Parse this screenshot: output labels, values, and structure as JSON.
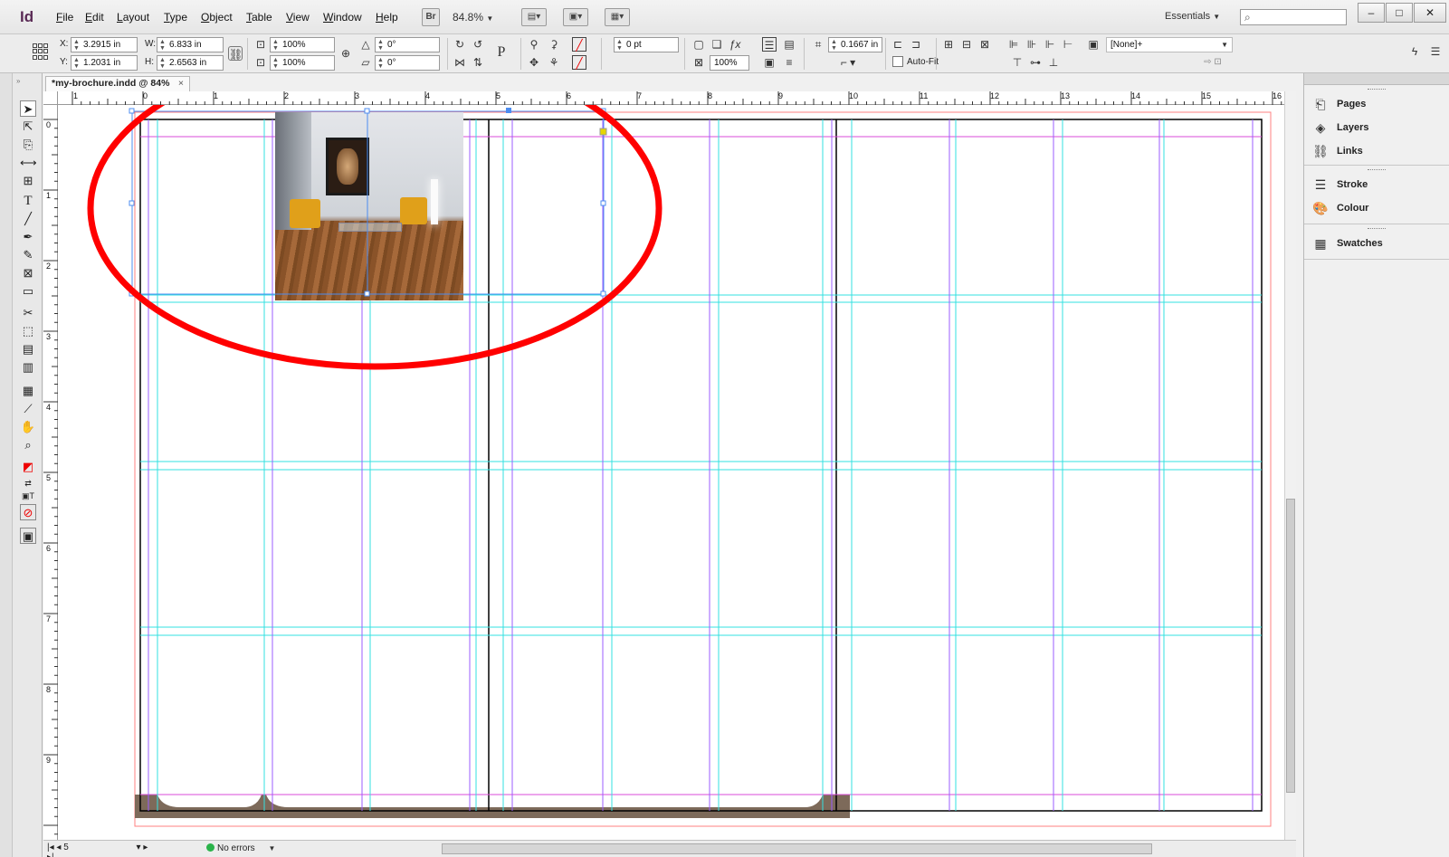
{
  "app": {
    "logo": "Id"
  },
  "menu": [
    "File",
    "Edit",
    "Layout",
    "Type",
    "Object",
    "Table",
    "View",
    "Window",
    "Help"
  ],
  "menubar": {
    "bridge_label": "Br",
    "zoom": "84.8%",
    "workspace": "Essentials",
    "search_placeholder": ""
  },
  "control": {
    "x_label": "X:",
    "x_value": "3.2915 in",
    "y_label": "Y:",
    "y_value": "1.2031 in",
    "w_label": "W:",
    "w_value": "6.833 in",
    "h_label": "H:",
    "h_value": "2.6563 in",
    "scale_x": "100%",
    "scale_y": "100%",
    "rotate": "0°",
    "shear": "0°",
    "stroke_weight": "0 pt",
    "opacity": "100%",
    "corner": "0.1667 in",
    "autofit": "Auto-Fit",
    "object_style": "[None]+"
  },
  "document": {
    "tab_title": "*my-brochure.indd @ 84%",
    "close": "×"
  },
  "ruler": {
    "top": [
      "1",
      "0",
      "1",
      "2",
      "3",
      "4",
      "5",
      "6",
      "7",
      "8",
      "9",
      "10",
      "11",
      "12",
      "13",
      "14",
      "15",
      "16"
    ],
    "left": [
      "0",
      "1",
      "2",
      "3",
      "4",
      "5",
      "6",
      "7",
      "8",
      "9"
    ]
  },
  "status": {
    "page": "5",
    "preflight": "No errors"
  },
  "panels": {
    "group1": [
      "Pages",
      "Layers",
      "Links"
    ],
    "group2": [
      "Stroke",
      "Colour"
    ],
    "group3": [
      "Swatches"
    ]
  },
  "colors": {
    "annotation_red": "#ff0000",
    "margin_guide": "#d94bd9",
    "column_guide": "#9b5cff",
    "ruler_guide": "#33e0e0",
    "bleed": "#ff8080",
    "footer_fill": "#7d6a5a"
  }
}
